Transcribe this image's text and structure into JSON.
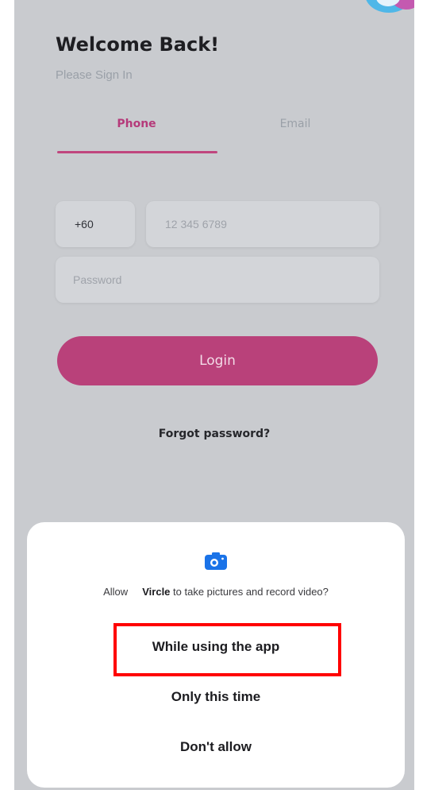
{
  "login": {
    "title": "Welcome Back!",
    "subtitle": "Please Sign In",
    "tabs": [
      {
        "label": "Phone",
        "active": true
      },
      {
        "label": "Email",
        "active": false
      }
    ],
    "country_code": "+60",
    "phone_placeholder": "12 345 6789",
    "password_placeholder": "Password",
    "login_label": "Login",
    "forgot_label": "Forgot password?"
  },
  "permission_dialog": {
    "icon": "camera-icon",
    "message_prefix": "Allow",
    "app_name": "Vircle",
    "message_suffix": "to take pictures and record video?",
    "options": [
      {
        "label": "While using the app",
        "highlighted": true
      },
      {
        "label": "Only this time"
      },
      {
        "label": "Don't allow"
      }
    ]
  },
  "colors": {
    "accent": "#b9417a",
    "highlight": "#ff0000",
    "background": "#c9cbcf",
    "dialog": "#ffffff"
  }
}
